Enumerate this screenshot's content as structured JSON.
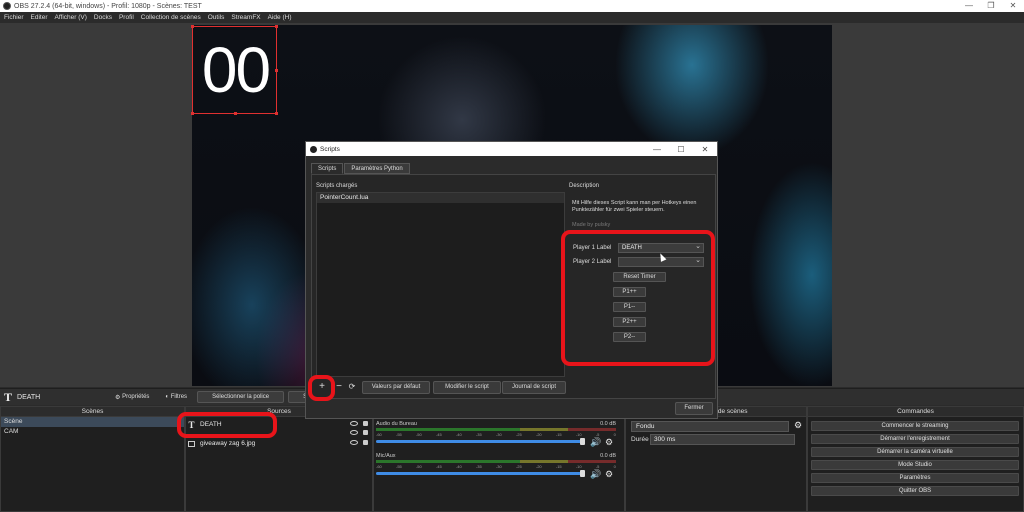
{
  "window": {
    "title": "OBS 27.2.4 (64-bit, windows) - Profil: 1080p - Scènes: TEST",
    "controls": [
      "—",
      "❐",
      "✕"
    ]
  },
  "menu": [
    "Fichier",
    "Editer",
    "Afficher (V)",
    "Docks",
    "Profil",
    "Collection de scènes",
    "Outils",
    "StreamFX",
    "Aide (H)"
  ],
  "preview": {
    "counter_text": "00"
  },
  "source_toolbar": {
    "source_name": "DEATH",
    "properties": "Propriétés",
    "filters": "Filtres",
    "select_font": "Sélectionner la police",
    "select_cut": "Sélection"
  },
  "docks": {
    "scenes": {
      "header": "Scènes",
      "items": [
        "Scène",
        "CAM"
      ]
    },
    "sources": {
      "header": "Sources",
      "items": [
        "DEATH",
        "giveaway zag 6.jpg"
      ]
    },
    "transitions": {
      "header": "Transitions de scènes",
      "type": "Fondu",
      "duration_label": "Durée",
      "duration_value": "300 ms"
    },
    "commands": {
      "header": "Commandes",
      "buttons": [
        "Commencer le streaming",
        "Démarrer l'enregistrement",
        "Démarrer la caméra virtuelle",
        "Mode Studio",
        "Paramètres",
        "Quitter OBS"
      ]
    }
  },
  "mixer": {
    "tracks": [
      {
        "name": "Audio du Bureau",
        "db": "0.0 dB"
      },
      {
        "name": "Mic/Aux",
        "db": "0.0 dB"
      }
    ],
    "ticks": [
      "-60",
      "-55",
      "-50",
      "-45",
      "-40",
      "-35",
      "-30",
      "-25",
      "-20",
      "-15",
      "-10",
      "-5",
      "0"
    ]
  },
  "scripts_dialog": {
    "title": "Scripts",
    "tabs": [
      "Scripts",
      "Paramètres Python"
    ],
    "loaded_label": "Scripts chargés",
    "loaded_scripts": [
      "PointerCount.lua"
    ],
    "description_label": "Description",
    "description": "Mit Hilfe dieses Script kann man per Hotkeys einen Punktezähler für zwei Spieler steuern.",
    "description_faded": "Made by pulsky",
    "player1_label": "Player 1 Label",
    "player1_value": "DEATH",
    "player2_label": "Player 2 Label",
    "player2_value": "",
    "buttons": [
      "Reset Timer",
      "P1++",
      "P1--",
      "P2++",
      "P2--"
    ],
    "footer": {
      "add": "+",
      "remove": "−",
      "reload": "⟳",
      "defaults": "Valeurs par défaut",
      "edit": "Modifier le script",
      "log": "Journal de script",
      "close": "Fermer"
    }
  }
}
